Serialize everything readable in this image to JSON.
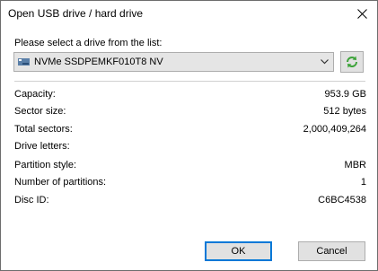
{
  "window": {
    "title": "Open USB drive / hard drive"
  },
  "drive_select": {
    "prompt": "Please select a drive from the list:",
    "selected": "NVMe SSDPEMKF010T8 NV",
    "icon": "drive-icon",
    "refresh_icon": "refresh-icon"
  },
  "info": [
    {
      "label": "Capacity:",
      "value": "953.9 GB"
    },
    {
      "label": "Sector size:",
      "value": "512 bytes"
    },
    {
      "label": "Total sectors:",
      "value": "2,000,409,264"
    },
    {
      "label": "Drive letters:",
      "value": ""
    },
    {
      "label": "Partition style:",
      "value": "MBR"
    },
    {
      "label": "Number of partitions:",
      "value": "1"
    },
    {
      "label": "Disc ID:",
      "value": "C6BC4538"
    }
  ],
  "buttons": {
    "ok": "OK",
    "cancel": "Cancel"
  },
  "colors": {
    "accent": "#0078d7",
    "refresh_icon": "#3da33a"
  }
}
